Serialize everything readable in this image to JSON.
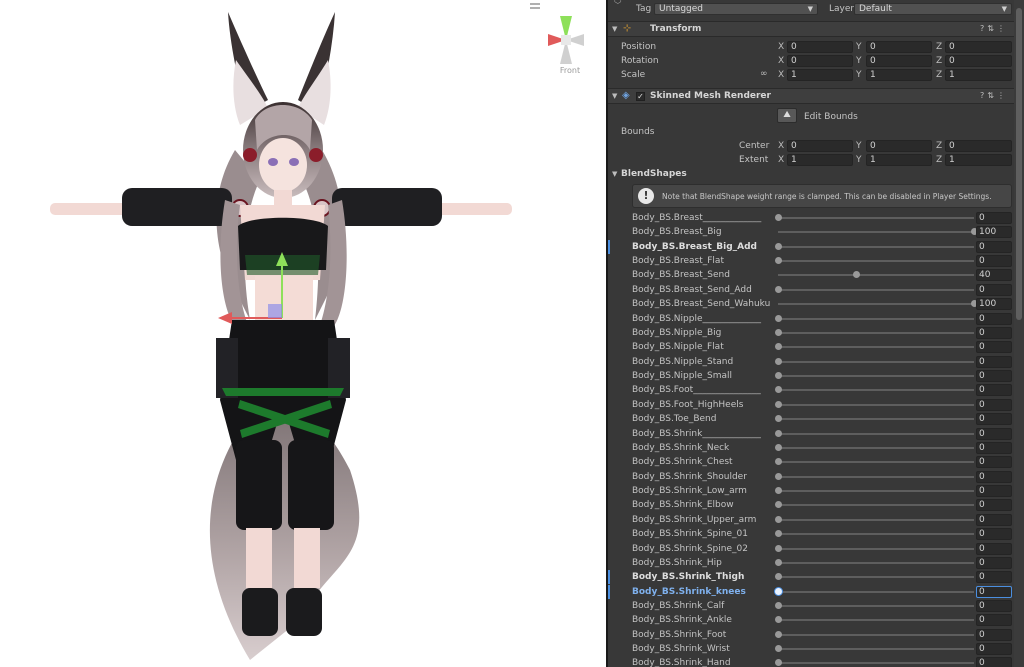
{
  "scene": {
    "gizmo_label": "Front",
    "colors": {
      "background": "#ffffff",
      "gizmo_x": "#e05a5a",
      "gizmo_y": "#8ee05a",
      "gizmo_z": "#c8c8c8"
    }
  },
  "inspector": {
    "tag_label": "Tag",
    "tag_value": "Untagged",
    "layer_label": "Layer",
    "layer_value": "Default",
    "transform": {
      "title": "Transform",
      "position_label": "Position",
      "rotation_label": "Rotation",
      "scale_label": "Scale",
      "position": {
        "x": "0",
        "y": "0",
        "z": "0"
      },
      "rotation": {
        "x": "0",
        "y": "0",
        "z": "0"
      },
      "scale": {
        "x": "1",
        "y": "1",
        "z": "1"
      },
      "axis_x": "X",
      "axis_y": "Y",
      "axis_z": "Z"
    },
    "smr": {
      "title": "Skinned Mesh Renderer",
      "edit_bounds_label": "Edit Bounds",
      "bounds_label": "Bounds",
      "center_label": "Center",
      "extent_label": "Extent",
      "center": {
        "x": "0",
        "y": "0",
        "z": "0"
      },
      "extent": {
        "x": "1",
        "y": "1",
        "z": "1"
      },
      "blendshapes_label": "BlendShapes",
      "note": "Note that BlendShape weight range is clamped. This can be disabled in Player Settings."
    },
    "blendshapes": [
      {
        "name": "Body_BS.Breast_____________",
        "value": 0
      },
      {
        "name": "Body_BS.Breast_Big",
        "value": 100
      },
      {
        "name": "Body_BS.Breast_Big_Add",
        "value": 0,
        "bold": true
      },
      {
        "name": "Body_BS.Breast_Flat",
        "value": 0
      },
      {
        "name": "Body_BS.Breast_Send",
        "value": 40
      },
      {
        "name": "Body_BS.Breast_Send_Add",
        "value": 0
      },
      {
        "name": "Body_BS.Breast_Send_Wahuku",
        "value": 100
      },
      {
        "name": "Body_BS.Nipple_____________",
        "value": 0
      },
      {
        "name": "Body_BS.Nipple_Big",
        "value": 0
      },
      {
        "name": "Body_BS.Nipple_Flat",
        "value": 0
      },
      {
        "name": "Body_BS.Nipple_Stand",
        "value": 0
      },
      {
        "name": "Body_BS.Nipple_Small",
        "value": 0
      },
      {
        "name": "Body_BS.Foot_______________",
        "value": 0
      },
      {
        "name": "Body_BS.Foot_HighHeels",
        "value": 0
      },
      {
        "name": "Body_BS.Toe_Bend",
        "value": 0
      },
      {
        "name": "Body_BS.Shrink_____________",
        "value": 0
      },
      {
        "name": "Body_BS.Shrink_Neck",
        "value": 0
      },
      {
        "name": "Body_BS.Shrink_Chest",
        "value": 0
      },
      {
        "name": "Body_BS.Shrink_Shoulder",
        "value": 0
      },
      {
        "name": "Body_BS.Shrink_Low_arm",
        "value": 0
      },
      {
        "name": "Body_BS.Shrink_Elbow",
        "value": 0
      },
      {
        "name": "Body_BS.Shrink_Upper_arm",
        "value": 0
      },
      {
        "name": "Body_BS.Shrink_Spine_01",
        "value": 0
      },
      {
        "name": "Body_BS.Shrink_Spine_02",
        "value": 0
      },
      {
        "name": "Body_BS.Shrink_Hip",
        "value": 0
      },
      {
        "name": "Body_BS.Shrink_Thigh",
        "value": 0,
        "bold": true
      },
      {
        "name": "Body_BS.Shrink_knees",
        "value": 0,
        "selected": true
      },
      {
        "name": "Body_BS.Shrink_Calf",
        "value": 0
      },
      {
        "name": "Body_BS.Shrink_Ankle",
        "value": 0
      },
      {
        "name": "Body_BS.Shrink_Foot",
        "value": 0
      },
      {
        "name": "Body_BS.Shrink_Wrist",
        "value": 0
      },
      {
        "name": "Body_BS.Shrink_Hand",
        "value": 0
      }
    ]
  }
}
